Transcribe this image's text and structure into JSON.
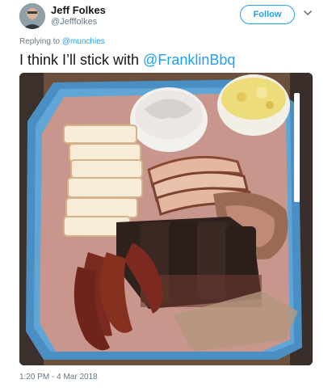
{
  "user": {
    "display_name": "Jeff Folkes",
    "handle": "@Jefffolkes",
    "avatar_icon": "user-avatar-icon"
  },
  "actions": {
    "follow_label": "Follow",
    "more_icon": "chevron-down-icon"
  },
  "reply": {
    "prefix": "Replying to ",
    "mention": "@munchies"
  },
  "tweet": {
    "text": "I think I’ll stick with ",
    "mention": "@FranklinBbq"
  },
  "media": {
    "description_icon": "photo-bbq-tray"
  },
  "meta": {
    "timestamp": "1:20 PM - 4 Mar 2018"
  },
  "colors": {
    "accent": "#1da1f2",
    "secondary_text": "#657786",
    "primary_text": "#14171a"
  }
}
